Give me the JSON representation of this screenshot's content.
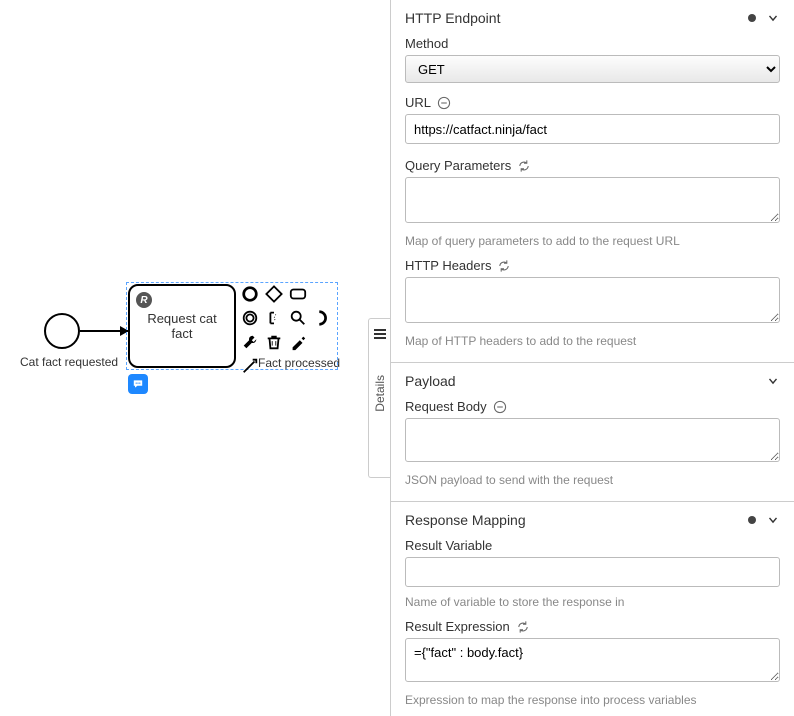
{
  "canvas": {
    "start_label": "Cat fact requested",
    "task_label": "Request cat fact",
    "task_marker": "R",
    "end_label": "Fact processed"
  },
  "tab": {
    "label": "Details"
  },
  "sections": {
    "http": {
      "title": "HTTP Endpoint",
      "method_label": "Method",
      "method_value": "GET",
      "url_label": "URL",
      "url_value": "https://catfact.ninja/fact",
      "query_label": "Query Parameters",
      "query_value": "",
      "query_hint": "Map of query parameters to add to the request URL",
      "headers_label": "HTTP Headers",
      "headers_value": "",
      "headers_hint": "Map of HTTP headers to add to the request"
    },
    "payload": {
      "title": "Payload",
      "body_label": "Request Body",
      "body_value": "",
      "body_hint": "JSON payload to send with the request"
    },
    "response": {
      "title": "Response Mapping",
      "var_label": "Result Variable",
      "var_value": "",
      "var_hint": "Name of variable to store the response in",
      "expr_label": "Result Expression",
      "expr_value": "={\"fact\" : body.fact}",
      "expr_hint": "Expression to map the response into process variables"
    }
  }
}
